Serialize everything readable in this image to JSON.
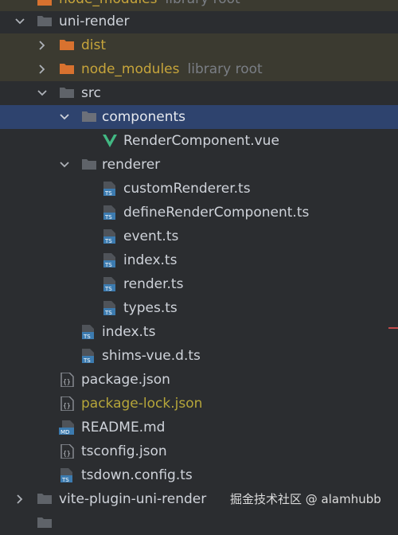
{
  "colors": {
    "background": "#2b2d30",
    "selected_row": "#2e436e",
    "excluded_row": "#3b3a30",
    "folder": "#5f6369",
    "excluded_folder": "#d8722f",
    "text": "#cfd3da",
    "excluded_text": "#c7a53b",
    "hint_text": "#7a7e85",
    "vue_green": "#42b883",
    "ts_blue": "#3c7bb0"
  },
  "top_partial": {
    "label": "node_modules",
    "hint": "library root"
  },
  "items": [
    {
      "label": "uni-render",
      "type": "folder",
      "expanded": true,
      "icon": "folder-icon"
    },
    {
      "label": "dist",
      "type": "folder",
      "expanded": false,
      "excluded": true,
      "icon": "folder-icon"
    },
    {
      "label": "node_modules",
      "hint": "library root",
      "type": "folder",
      "expanded": false,
      "excluded": true,
      "icon": "folder-icon"
    },
    {
      "label": "src",
      "type": "folder",
      "expanded": true,
      "icon": "folder-icon"
    },
    {
      "label": "components",
      "type": "folder",
      "expanded": true,
      "selected": true,
      "icon": "folder-icon"
    },
    {
      "label": "RenderComponent.vue",
      "type": "file",
      "icon": "vue-file-icon"
    },
    {
      "label": "renderer",
      "type": "folder",
      "expanded": true,
      "icon": "folder-icon"
    },
    {
      "label": "customRenderer.ts",
      "type": "file",
      "icon": "typescript-file-icon"
    },
    {
      "label": "defineRenderComponent.ts",
      "type": "file",
      "icon": "typescript-file-icon"
    },
    {
      "label": "event.ts",
      "type": "file",
      "icon": "typescript-file-icon"
    },
    {
      "label": "index.ts",
      "type": "file",
      "icon": "typescript-file-icon"
    },
    {
      "label": "render.ts",
      "type": "file",
      "icon": "typescript-file-icon"
    },
    {
      "label": "types.ts",
      "type": "file",
      "icon": "typescript-file-icon"
    },
    {
      "label": "index.ts",
      "type": "file",
      "icon": "typescript-file-icon"
    },
    {
      "label": "shims-vue.d.ts",
      "type": "file",
      "icon": "typescript-file-icon"
    },
    {
      "label": "package.json",
      "type": "file",
      "icon": "json-file-icon"
    },
    {
      "label": "package-lock.json",
      "type": "file",
      "modified": true,
      "icon": "json-file-icon"
    },
    {
      "label": "README.md",
      "type": "file",
      "icon": "markdown-file-icon"
    },
    {
      "label": "tsconfig.json",
      "type": "file",
      "icon": "json-file-icon"
    },
    {
      "label": "tsdown.config.ts",
      "type": "file",
      "icon": "typescript-file-icon"
    },
    {
      "label": "vite-plugin-uni-render",
      "type": "folder",
      "expanded": false,
      "icon": "folder-icon"
    }
  ],
  "watermark": "掘金技术社区 @ alamhubb"
}
